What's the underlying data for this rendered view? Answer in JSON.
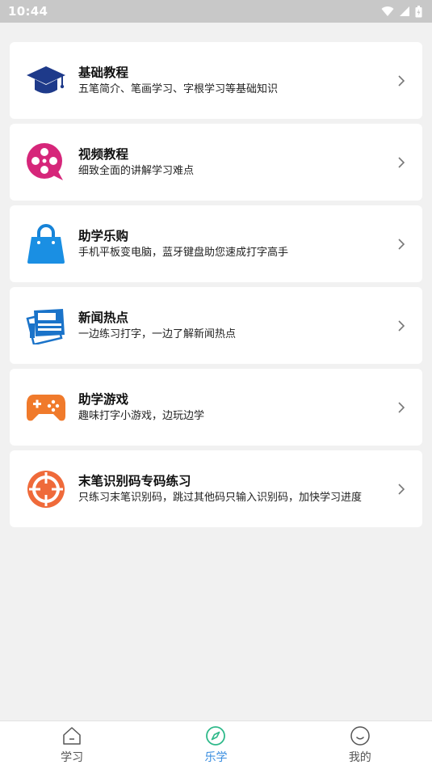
{
  "status_bar": {
    "time": "10:44"
  },
  "cards": [
    {
      "title": "基础教程",
      "desc": "五笔简介、笔画学习、字根学习等基础知识",
      "icon": "graduation-cap-icon"
    },
    {
      "title": "视频教程",
      "desc": "细致全面的讲解学习难点",
      "icon": "film-reel-icon"
    },
    {
      "title": "助学乐购",
      "desc": "手机平板变电脑，蓝牙键盘助您速成打字高手",
      "icon": "shopping-bag-icon"
    },
    {
      "title": "新闻热点",
      "desc": "一边练习打字，一边了解新闻热点",
      "icon": "newspaper-icon"
    },
    {
      "title": "助学游戏",
      "desc": "趣味打字小游戏，边玩边学",
      "icon": "gamepad-icon"
    },
    {
      "title": "末笔识别码专码练习",
      "desc": "只练习末笔识别码，跳过其他码只输入识别码，加快学习进度",
      "icon": "target-icon"
    }
  ],
  "tabs": [
    {
      "label": "学习",
      "icon": "home-icon",
      "active": false
    },
    {
      "label": "乐学",
      "icon": "compass-icon",
      "active": true
    },
    {
      "label": "我的",
      "icon": "smile-icon",
      "active": false
    }
  ],
  "colors": {
    "accent": "#3a8ee0",
    "active_tab_icon": "#2fb98a",
    "status_bar": "#c8c8c8",
    "background": "#f1f1f1"
  }
}
